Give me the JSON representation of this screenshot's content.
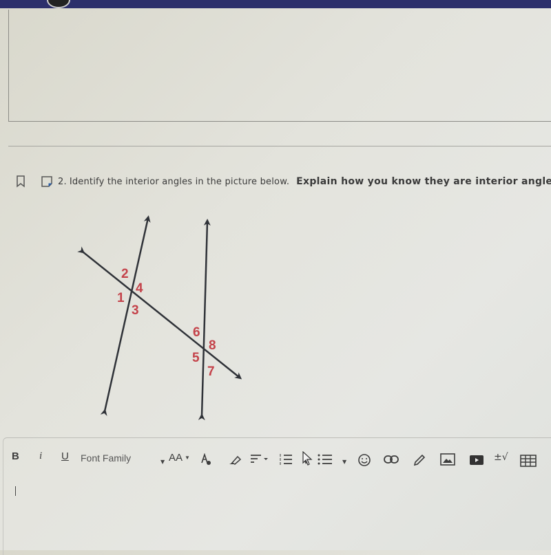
{
  "question": {
    "number": "2.",
    "text": "Identify the interior angles in the picture below.",
    "bold_text": "Explain how you know they are interior angles"
  },
  "diagram": {
    "angle_labels": [
      "1",
      "2",
      "3",
      "4",
      "5",
      "6",
      "7",
      "8"
    ],
    "label_color": "#c4424a",
    "line_color": "#2f3238"
  },
  "editor": {
    "toolbar": {
      "bold": "B",
      "italic": "i",
      "underline": "U",
      "font_family": "Font Family",
      "font_size": "AA",
      "math": "±√"
    },
    "content": ""
  },
  "colors": {
    "topbar": "#2c2f6b",
    "label_red": "#c4424a"
  }
}
